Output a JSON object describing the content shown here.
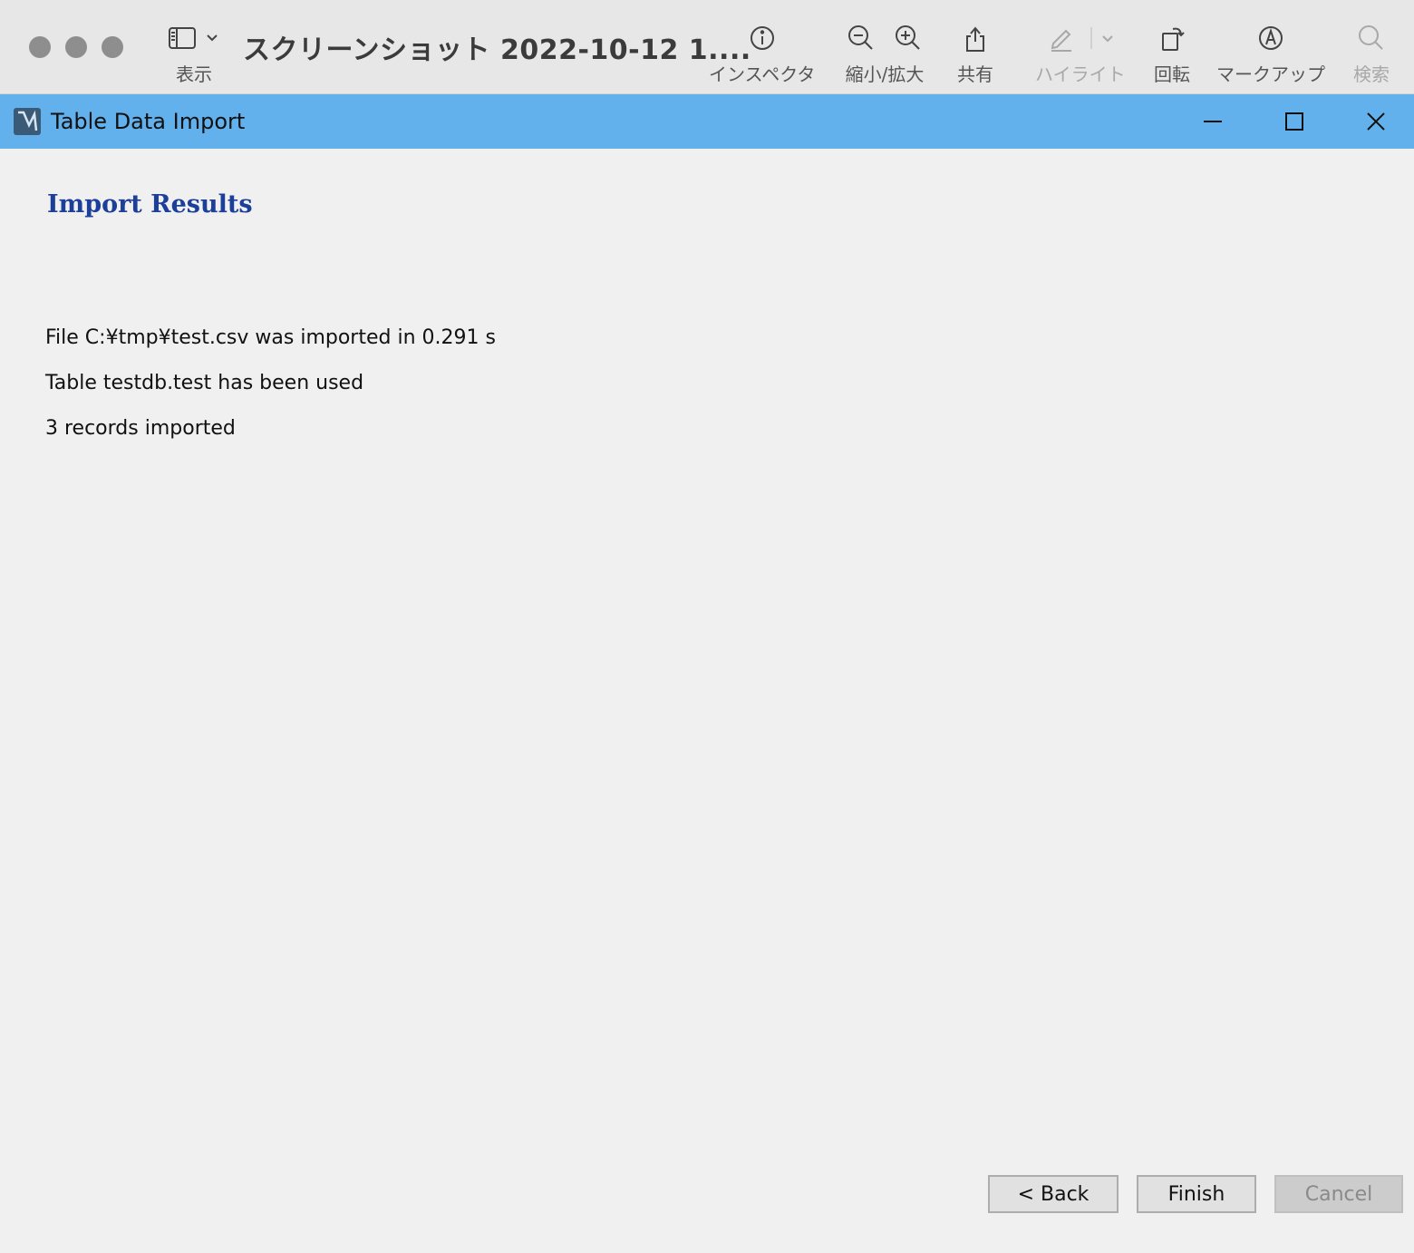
{
  "mac_toolbar": {
    "document_title": "スクリーンショット 2022-10-12 1....",
    "view_label": "表示",
    "inspector_label": "インスペクタ",
    "zoom_label": "縮小/拡大",
    "share_label": "共有",
    "highlight_label": "ハイライト",
    "rotate_label": "回転",
    "markup_label": "マークアップ",
    "search_label": "検索"
  },
  "window": {
    "title": "Table Data Import"
  },
  "dialog": {
    "section_title": "Import Results",
    "results": [
      "File C:¥tmp¥test.csv was imported in 0.291 s",
      "Table testdb.test has been used",
      "3 records imported"
    ],
    "buttons": {
      "back": "< Back",
      "finish": "Finish",
      "cancel": "Cancel"
    }
  },
  "colors": {
    "titlebar": "#62b1ec",
    "section_title": "#1c3f9a",
    "body_bg": "#f0f0f0"
  }
}
